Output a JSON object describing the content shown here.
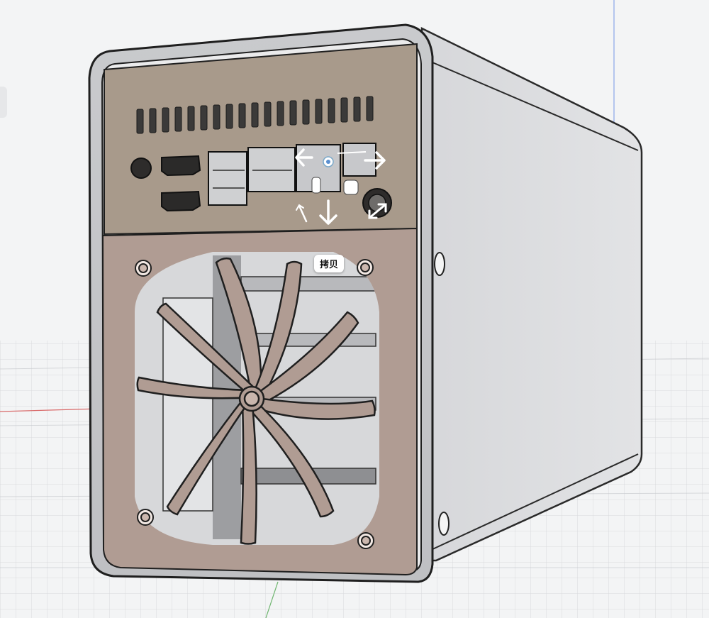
{
  "viewport": {
    "copy_label": "拷贝"
  },
  "colors": {
    "background": "#f3f4f5",
    "case_shell": "#d8d9dc",
    "io_panel": "#a89a8b",
    "fan_panel": "#b09c93",
    "x_axis": "#d96a6a",
    "y_axis": "#6fb56f",
    "z_axis": "#8aa6e8"
  },
  "icons": [
    "move-left-arrow-icon",
    "move-right-arrow-icon",
    "move-down-arrow-icon",
    "origin-point-icon",
    "rotate-handle-icon",
    "scale-handle-icon",
    "resize-diagonal-icon"
  ]
}
